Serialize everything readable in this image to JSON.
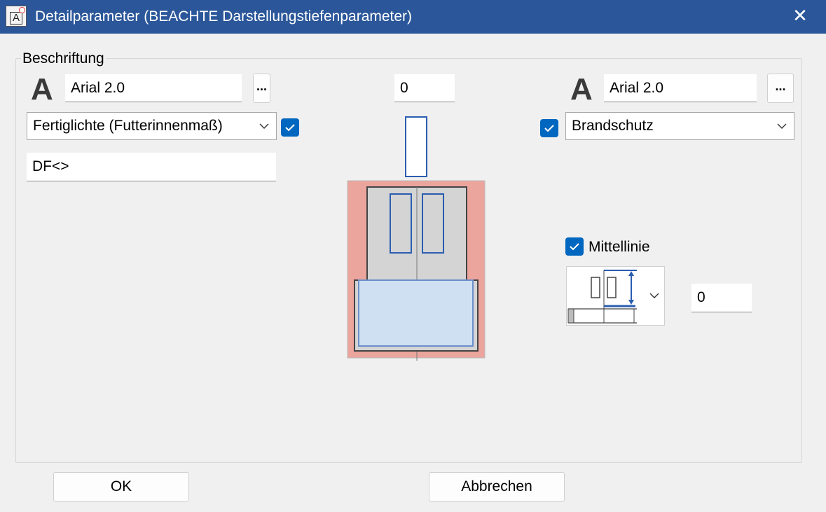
{
  "window": {
    "title": "Detailparameter (BEACHTE Darstellungstiefenparameter)",
    "icon": "app-a-icon",
    "close_label": "✕"
  },
  "group": {
    "label": "Beschriftung"
  },
  "left": {
    "font_glyph": "A",
    "font_value": "Arial 2.0",
    "font_button_label": "...",
    "type_combo_value": "Fertiglichte (Futterinnenmaß)",
    "type_checked": true,
    "text_value": "DF<>"
  },
  "center": {
    "offset_value": "0"
  },
  "right": {
    "font_glyph": "A",
    "font_value": "Arial 2.0",
    "font_button_label": "...",
    "type_checked": true,
    "type_combo_value": "Brandschutz",
    "mittellinie_checked": true,
    "mittellinie_label": "Mittellinie",
    "dimension_value": "0"
  },
  "footer": {
    "ok_label": "OK",
    "cancel_label": "Abbrechen"
  },
  "colors": {
    "titlebar": "#2b579a",
    "accent": "#0067c0",
    "wall": "#eba59d",
    "glass": "#cfe0f2",
    "outline_blue": "#2a5db0"
  }
}
